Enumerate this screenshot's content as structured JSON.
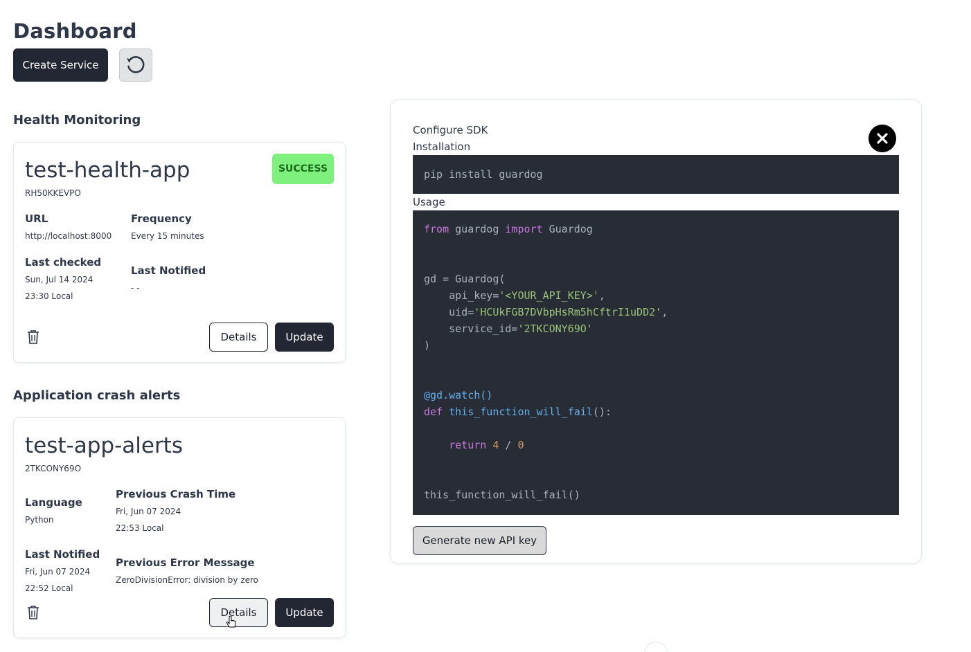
{
  "page": {
    "title": "Dashboard"
  },
  "toolbar": {
    "create_label": "Create Service",
    "refresh_icon": "refresh-icon"
  },
  "health": {
    "section_title": "Health Monitoring",
    "card": {
      "name": "test-health-app",
      "id": "RH50KKEVPO",
      "status": "SUCCESS",
      "status_color": "#7ef07e",
      "url_label": "URL",
      "url_value": "http://localhost:8000",
      "frequency_label": "Frequency",
      "frequency_value": "Every 15 minutes",
      "last_checked_label": "Last checked",
      "last_checked_date": "Sun, Jul 14 2024",
      "last_checked_time": "23:30 Local",
      "last_notified_label": "Last Notified",
      "last_notified_value": "- -",
      "details_label": "Details",
      "update_label": "Update"
    }
  },
  "crash": {
    "section_title": "Application crash alerts",
    "card": {
      "name": "test-app-alerts",
      "id": "2TKCONY69O",
      "language_label": "Language",
      "language_value": "Python",
      "prev_crash_label": "Previous Crash Time",
      "prev_crash_date": "Fri, Jun 07 2024",
      "prev_crash_time": "22:53 Local",
      "last_notified_label": "Last Notified",
      "last_notified_date": "Fri, Jun 07 2024",
      "last_notified_time": "22:52 Local",
      "prev_error_label": "Previous Error Message",
      "prev_error_value": "ZeroDivisionError: division by zero",
      "details_label": "Details",
      "update_label": "Update"
    }
  },
  "sdk_modal": {
    "title": "Configure SDK",
    "installation_label": "Installation",
    "install_cmd": "pip install guardog",
    "usage_label": "Usage",
    "code": {
      "from": "from",
      "module": "guardog",
      "import": "import",
      "cls": "Guardog",
      "gd_assign": "gd = Guardog(",
      "api_key_param": "    api_key=",
      "api_key_val": "'<YOUR_API_KEY>'",
      "uid_param": "    uid=",
      "uid_val": "'HCUkFGB7DVbpHsRm5hCftrI1uDD2'",
      "service_param": "    service_id=",
      "service_val": "'2TKCONY69O'",
      "close_paren": ")",
      "decorator": "@gd.watch()",
      "def": "def",
      "fn_name": "this_function_will_fail",
      "fn_sig": "():",
      "return": "return",
      "num4": "4",
      "div": " / ",
      "num0": "0",
      "call": "this_function_will_fail()",
      "comma": ","
    },
    "generate_label": "Generate new API key"
  },
  "colors": {
    "primary_dark": "#232733",
    "code_bg": "#282c34",
    "success": "#7ef07e"
  }
}
